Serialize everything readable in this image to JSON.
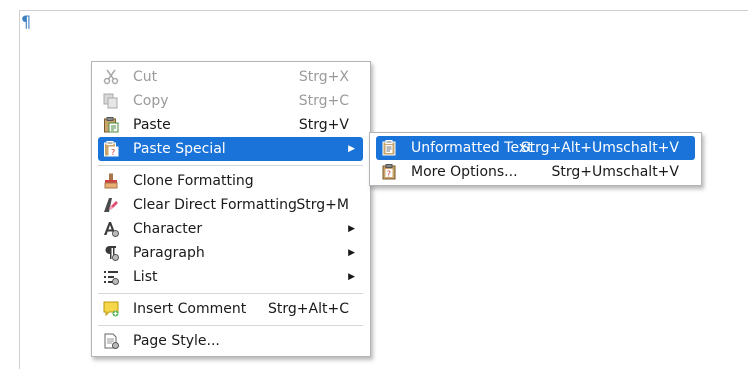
{
  "document": {
    "paragraph_mark": "¶"
  },
  "context_menu": {
    "items": [
      {
        "label": "Cut",
        "shortcut": "Strg+X",
        "icon": "scissors-icon",
        "enabled": false
      },
      {
        "label": "Copy",
        "shortcut": "Strg+C",
        "icon": "copy-icon",
        "enabled": false
      },
      {
        "label": "Paste",
        "shortcut": "Strg+V",
        "icon": "paste-icon",
        "enabled": true
      },
      {
        "label": "Paste Special",
        "shortcut": "",
        "icon": "paste-special-icon",
        "enabled": true,
        "submenu": true,
        "highlighted": true
      },
      {
        "label": "Clone Formatting",
        "shortcut": "",
        "icon": "paintbrush-icon",
        "enabled": true
      },
      {
        "label": "Clear Direct Formatting",
        "shortcut": "Strg+M",
        "icon": "clear-formatting-icon",
        "enabled": true
      },
      {
        "label": "Character",
        "shortcut": "",
        "icon": "character-icon",
        "enabled": true,
        "submenu": true
      },
      {
        "label": "Paragraph",
        "shortcut": "",
        "icon": "paragraph-icon",
        "enabled": true,
        "submenu": true
      },
      {
        "label": "List",
        "shortcut": "",
        "icon": "list-icon",
        "enabled": true,
        "submenu": true
      },
      {
        "label": "Insert Comment",
        "shortcut": "Strg+Alt+C",
        "icon": "comment-icon",
        "enabled": true
      },
      {
        "label": "Page Style...",
        "shortcut": "",
        "icon": "page-style-icon",
        "enabled": true
      }
    ],
    "submenu_arrow": "▶"
  },
  "paste_special_submenu": {
    "items": [
      {
        "label": "Unformatted Text",
        "shortcut": "Strg+Alt+Umschalt+V",
        "icon": "clipboard-text-icon",
        "highlighted": true
      },
      {
        "label": "More Options...",
        "shortcut": "Strg+Umschalt+V",
        "icon": "clipboard-question-icon"
      }
    ]
  },
  "colors": {
    "highlight": "#1a73d9",
    "disabled_text": "#9a9a9a",
    "pilcrow": "#3d7fc0"
  }
}
